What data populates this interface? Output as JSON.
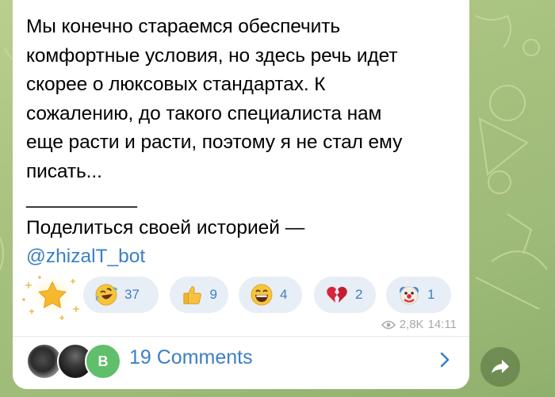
{
  "message": {
    "lines": [
      "Мы конечно стараемся обеспечить",
      "комфортные условия, но здесь речь идет",
      "скорее о люксовых стандартах. К",
      "сожалению, до такого специалиста нам",
      "еще расти и расти, поэтому я не стал ему",
      "писать..."
    ],
    "separator": "___________",
    "share_text": "Поделиться своей историей —",
    "bot_link": "@zhizalT_bot"
  },
  "reactions": [
    {
      "icon": "star-icon",
      "count": ""
    },
    {
      "icon": "rolling-laughing-emoji-icon",
      "count": "37"
    },
    {
      "icon": "thumbs-up-icon",
      "count": "9"
    },
    {
      "icon": "grinning-face-icon",
      "count": "4"
    },
    {
      "icon": "broken-heart-icon",
      "count": "2"
    },
    {
      "icon": "clown-face-icon",
      "count": "1"
    }
  ],
  "meta": {
    "views": "2,8K",
    "time": "14:11"
  },
  "comments": {
    "label": "19 Comments",
    "avatar_letter": "B"
  },
  "colors": {
    "accent": "#3b7fc4",
    "reaction_bg": "#e7eef6",
    "bubble_bg": "#ffffff",
    "wallpaper": "#a7c17e"
  }
}
